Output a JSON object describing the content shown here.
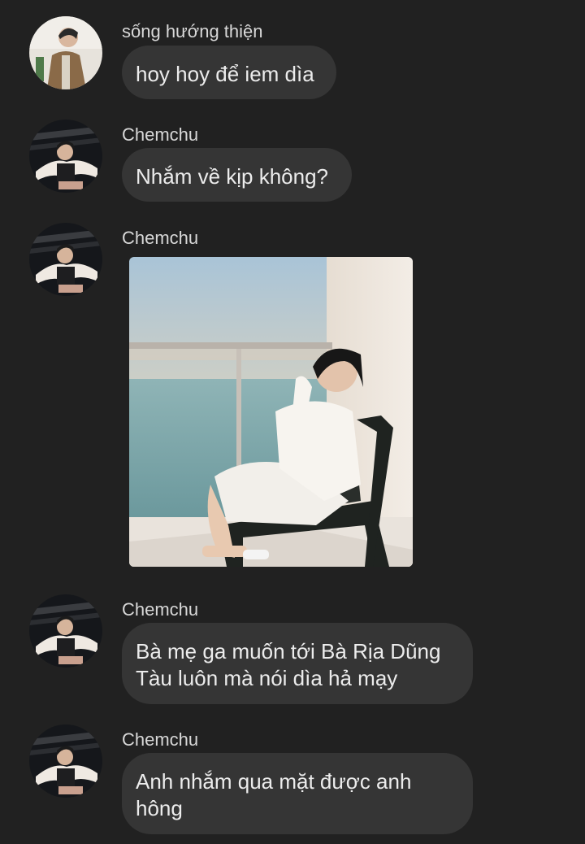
{
  "messages": [
    {
      "sender": "sống hướng thiện",
      "text": "hoy hoy để iem dìa",
      "avatar_icon": "avatar-user-1"
    },
    {
      "sender": "Chemchu",
      "text": "Nhắm về kịp không?",
      "avatar_icon": "avatar-chemchu"
    },
    {
      "sender": "Chemchu",
      "image_icon": "photo-balcony-sea"
    },
    {
      "sender": "Chemchu",
      "lines": [
        "Bà mẹ ga muốn tới Bà Rịa Dũng",
        "Tàu luôn mà nói dìa hả mạy"
      ]
    },
    {
      "sender": "Chemchu",
      "lines": [
        "Anh nhắm qua mặt được anh",
        "hông"
      ]
    }
  ],
  "colors": {
    "background": "#212121",
    "bubble": "#353535",
    "text": "#ececec",
    "sender": "#d8d8d8"
  }
}
